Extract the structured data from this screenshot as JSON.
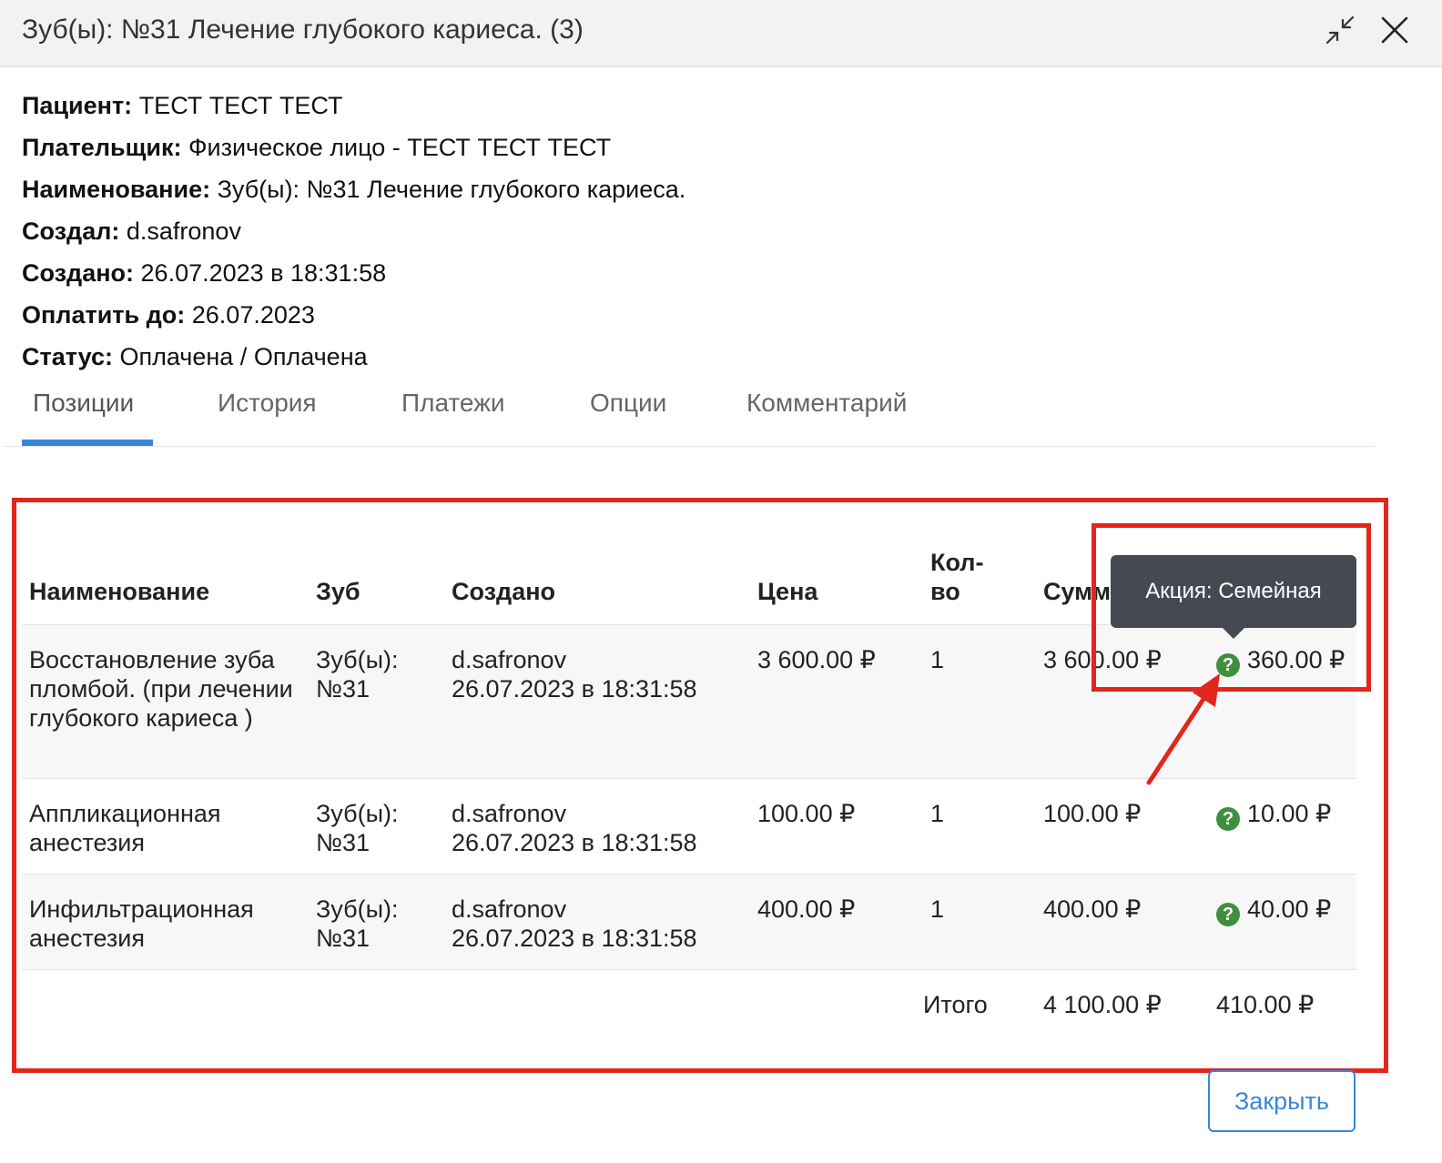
{
  "window": {
    "title": "Зуб(ы): №31 Лечение глубокого кариеса. (3)",
    "minimize_icon": "collapse-arrows-icon",
    "close_icon": "close-icon"
  },
  "info": [
    {
      "label": "Пациент:",
      "value": "ТЕСТ ТЕСТ ТЕСТ"
    },
    {
      "label": "Плательщик:",
      "value": "Физическое лицо - ТЕСТ ТЕСТ ТЕСТ"
    },
    {
      "label": "Наименование:",
      "value": "Зуб(ы): №31 Лечение глубокого кариеса."
    },
    {
      "label": "Создал:",
      "value": "d.safronov"
    },
    {
      "label": "Создано:",
      "value": "26.07.2023 в 18:31:58"
    },
    {
      "label": "Оплатить до:",
      "value": "26.07.2023"
    },
    {
      "label": "Статус:",
      "value": "Оплачена / Оплачена"
    }
  ],
  "tabs": [
    {
      "label": "Позиции",
      "active": true
    },
    {
      "label": "История",
      "active": false
    },
    {
      "label": "Платежи",
      "active": false
    },
    {
      "label": "Опции",
      "active": false
    },
    {
      "label": "Комментарий",
      "active": false
    }
  ],
  "table": {
    "headers": {
      "name": "Наименование",
      "tooth": "Зуб",
      "created": "Создано",
      "price": "Цена",
      "qty_line1": "Кол-",
      "qty_line2": "во",
      "sum": "Сумм"
    },
    "rows": [
      {
        "name": "Восстановление зуба пломбой. (при лечении глубокого кариеса )",
        "tooth_line1": "Зуб(ы):",
        "tooth_line2": "№31",
        "created_by": "d.safronov",
        "created_at": "26.07.2023 в 18:31:58",
        "price": "3 600.00 ₽",
        "qty": "1",
        "sum": "3 600.00 ₽",
        "discount": "360.00 ₽"
      },
      {
        "name": "Аппликационная анестезия",
        "tooth_line1": "Зуб(ы):",
        "tooth_line2": "№31",
        "created_by": "d.safronov",
        "created_at": "26.07.2023 в 18:31:58",
        "price": "100.00 ₽",
        "qty": "1",
        "sum": "100.00 ₽",
        "discount": "10.00 ₽"
      },
      {
        "name": "Инфильтрационная анестезия",
        "tooth_line1": "Зуб(ы):",
        "tooth_line2": "№31",
        "created_by": "d.safronov",
        "created_at": "26.07.2023 в 18:31:58",
        "price": "400.00 ₽",
        "qty": "1",
        "sum": "400.00 ₽",
        "discount": "40.00 ₽"
      }
    ],
    "total": {
      "label": "Итого",
      "sum": "4 100.00 ₽",
      "discount": "410.00 ₽"
    },
    "discount_icon": "question-circle-icon",
    "discount_icon_glyph": "?"
  },
  "tooltip": {
    "text": "Акция: Семейная"
  },
  "footer": {
    "close_label": "Закрыть"
  },
  "colors": {
    "accent": "#3a86d9",
    "annotation": "#e3261c",
    "discount_icon": "#3f8f3f",
    "tooltip_bg": "#454a52"
  }
}
